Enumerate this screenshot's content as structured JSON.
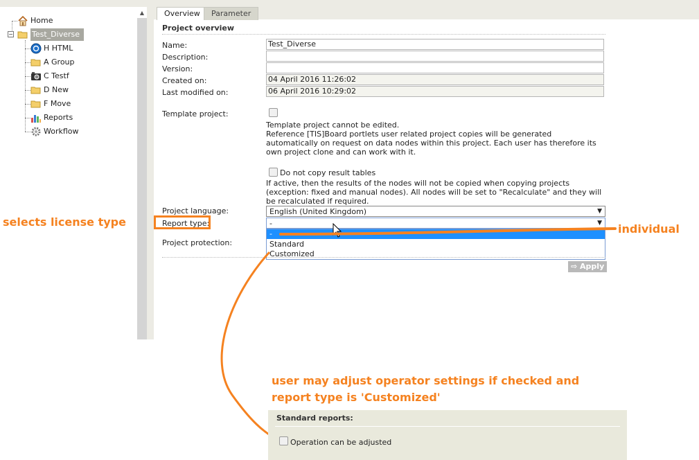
{
  "tree": {
    "items": [
      {
        "label": "Home",
        "icon": "home-icon"
      },
      {
        "label": "Test_Diverse",
        "icon": "folder-open-icon"
      },
      {
        "label": "H HTML",
        "icon": "html-globe-icon"
      },
      {
        "label": "A Group",
        "icon": "folder-icon"
      },
      {
        "label": "C Testf",
        "icon": "camera-icon"
      },
      {
        "label": "D New",
        "icon": "folder-icon"
      },
      {
        "label": "F Move",
        "icon": "folder-icon"
      },
      {
        "label": "Reports",
        "icon": "bar-chart-icon"
      },
      {
        "label": "Workflow",
        "icon": "gear-icon"
      }
    ]
  },
  "tabs": [
    {
      "label": "Overview",
      "active": true
    },
    {
      "label": "Parameter",
      "active": false
    }
  ],
  "overview": {
    "section_title": "Project overview",
    "fields": {
      "name_label": "Name:",
      "name_value": "Test_Diverse",
      "description_label": "Description:",
      "description_value": "",
      "version_label": "Version:",
      "version_value": "",
      "created_label": "Created on:",
      "created_value": "04 April 2016 11:26:02",
      "modified_label": "Last modified on:",
      "modified_value": "06 April 2016 10:29:02"
    },
    "template_label": "Template project:",
    "template_note": "Template project cannot be edited.",
    "template_desc": "Reference [TIS]Board portlets user related project copies will be generated automatically on request on data nodes within this project. Each user has therefore its own project clone and can work with it.",
    "nocopy_label": "Do not copy result tables",
    "nocopy_desc": "If active, then the results of the nodes will not be copied when copying projects (exception: fixed and manual nodes). All nodes will be set to \"Recalculate\" and they will be recalculated if required.",
    "language_label": "Project language:",
    "language_value": "English (United Kingdom)",
    "report_type_label": "Report type:",
    "report_type_value": "-",
    "report_type_options": [
      "-",
      "Standard",
      "Customized"
    ],
    "protection_label": "Project protection:",
    "apply_label": "Apply"
  },
  "annotations": {
    "left": "selects license type",
    "right": "individual",
    "bottom_line1": "user may adjust operator settings if checked and",
    "bottom_line2": "report type is 'Customized'",
    "color": "#f58220"
  },
  "standard_reports": {
    "title": "Standard reports:",
    "checkbox_label": "Operation can be adjusted"
  }
}
